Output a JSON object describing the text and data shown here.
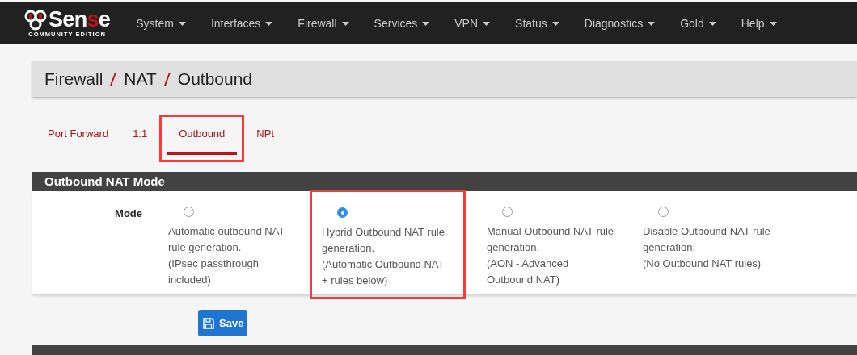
{
  "navbar": {
    "logo": {
      "parts": [
        {
          "text": "Sen",
          "accent": false
        },
        {
          "text": "s",
          "accent": true
        },
        {
          "text": "e",
          "accent": false
        }
      ],
      "subtitle": "COMMUNITY EDITION"
    },
    "menus": [
      {
        "label": "System"
      },
      {
        "label": "Interfaces"
      },
      {
        "label": "Firewall"
      },
      {
        "label": "Services"
      },
      {
        "label": "VPN"
      },
      {
        "label": "Status"
      },
      {
        "label": "Diagnostics"
      },
      {
        "label": "Gold"
      },
      {
        "label": "Help"
      }
    ]
  },
  "breadcrumb": [
    "Firewall",
    "NAT",
    "Outbound"
  ],
  "tabs": [
    {
      "label": "Port Forward",
      "selected": false,
      "highlighted": false
    },
    {
      "label": "1:1",
      "selected": false,
      "highlighted": false
    },
    {
      "label": "Outbound",
      "selected": true,
      "highlighted": true
    },
    {
      "label": "NPt",
      "selected": false,
      "highlighted": false
    }
  ],
  "section": {
    "title": "Outbound NAT Mode",
    "field_label": "Mode",
    "options": [
      {
        "lines": [
          "Automatic outbound NAT rule generation.",
          "(IPsec passthrough included)"
        ],
        "selected": false,
        "highlighted": false
      },
      {
        "lines": [
          "Hybrid Outbound NAT rule generation.",
          "(Automatic Outbound NAT + rules below)"
        ],
        "selected": true,
        "highlighted": true
      },
      {
        "lines": [
          "Manual Outbound NAT rule generation.",
          "(AON - Advanced Outbound NAT)"
        ],
        "selected": false,
        "highlighted": false
      },
      {
        "lines": [
          "Disable Outbound NAT rule generation.",
          "(No Outbound NAT rules)"
        ],
        "selected": false,
        "highlighted": false
      }
    ]
  },
  "save_button": {
    "label": "Save"
  }
}
